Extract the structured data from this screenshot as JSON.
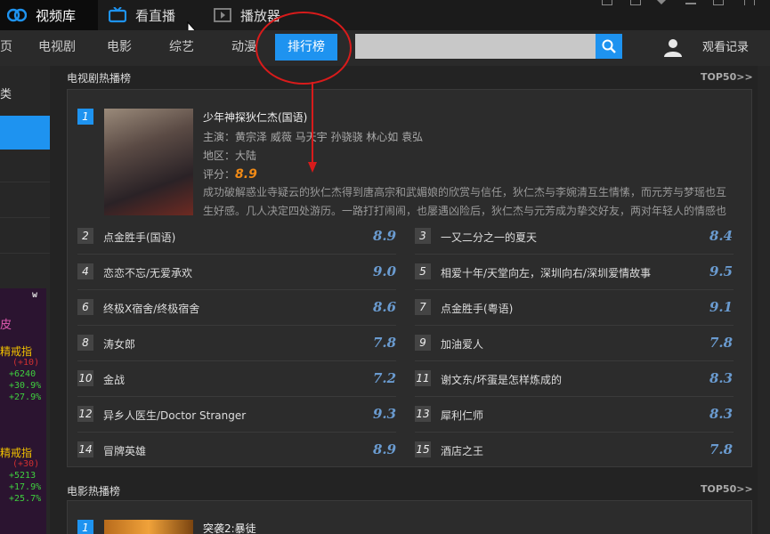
{
  "topbar": {
    "tabs": [
      {
        "label": "视频库",
        "icon": "film-reel-icon"
      },
      {
        "label": "看直播",
        "icon": "tv-icon"
      },
      {
        "label": "播放器",
        "icon": "player-icon"
      }
    ]
  },
  "nav": {
    "home_partial": "页",
    "items": [
      "电视剧",
      "电影",
      "综艺",
      "动漫"
    ],
    "active": "排行榜",
    "search_placeholder": "",
    "history": "观看记录"
  },
  "sidebar": {
    "category_partial": "类",
    "game_overlay": {
      "badge": "w",
      "lines": [
        "皮",
        "精戒指",
        "(+10)",
        "+6240",
        "+30.9%",
        "+27.9%",
        "精戒指",
        "(+30)",
        "+5213",
        "+17.9%",
        "+25.7%"
      ]
    }
  },
  "tv_section": {
    "title": "电视剧热播榜",
    "more": "TOP50>>",
    "featured": {
      "rank": "1",
      "title": "少年神探狄仁杰(国语)",
      "cast": "主演：黄宗泽 威薇 马天宇 孙骁骁 林心如 袁弘",
      "region": "地区：大陆",
      "score_label": "评分：",
      "score": "8.9",
      "desc": "成功破解惑业寺疑云的狄仁杰得到唐高宗和武媚娘的欣赏与信任，狄仁杰与李婉清互生情愫，而元芳与梦瑶也互生好感。几人决定四处游历。一路打打闹闹，也屡遇凶险后，狄仁杰与元芳成为挚交好友，两对年轻人的情感也"
    },
    "left_list": [
      {
        "rank": "2",
        "title": "点金胜手(国语)",
        "score": "8.9"
      },
      {
        "rank": "4",
        "title": "恋恋不忘/无爱承欢",
        "score": "9.0"
      },
      {
        "rank": "6",
        "title": "终极X宿舍/终极宿舍",
        "score": "8.6"
      },
      {
        "rank": "8",
        "title": "涛女郎",
        "score": "7.8"
      },
      {
        "rank": "10",
        "title": "金战",
        "score": "7.2"
      },
      {
        "rank": "12",
        "title": "异乡人医生/Doctor Stranger",
        "score": "9.3"
      },
      {
        "rank": "14",
        "title": "冒牌英雄",
        "score": "8.9"
      }
    ],
    "right_list": [
      {
        "rank": "3",
        "title": "一又二分之一的夏天",
        "score": "8.4"
      },
      {
        "rank": "5",
        "title": "相爱十年/天堂向左，深圳向右/深圳爱情故事",
        "score": "9.5"
      },
      {
        "rank": "7",
        "title": "点金胜手(粤语)",
        "score": "9.1"
      },
      {
        "rank": "9",
        "title": "加油爱人",
        "score": "7.8"
      },
      {
        "rank": "11",
        "title": "谢文东/坏蛋是怎样炼成的",
        "score": "8.3"
      },
      {
        "rank": "13",
        "title": "犀利仁师",
        "score": "8.3"
      },
      {
        "rank": "15",
        "title": "酒店之王",
        "score": "7.8"
      }
    ]
  },
  "movie_section": {
    "title": "电影热播榜",
    "more": "TOP50>>",
    "featured": {
      "rank": "1",
      "title": "突袭2:暴徒"
    }
  },
  "colors": {
    "accent": "#1e93f0",
    "score": "#6a9bd0",
    "featured_score": "#f08a16",
    "annotation": "#d81b1b"
  }
}
